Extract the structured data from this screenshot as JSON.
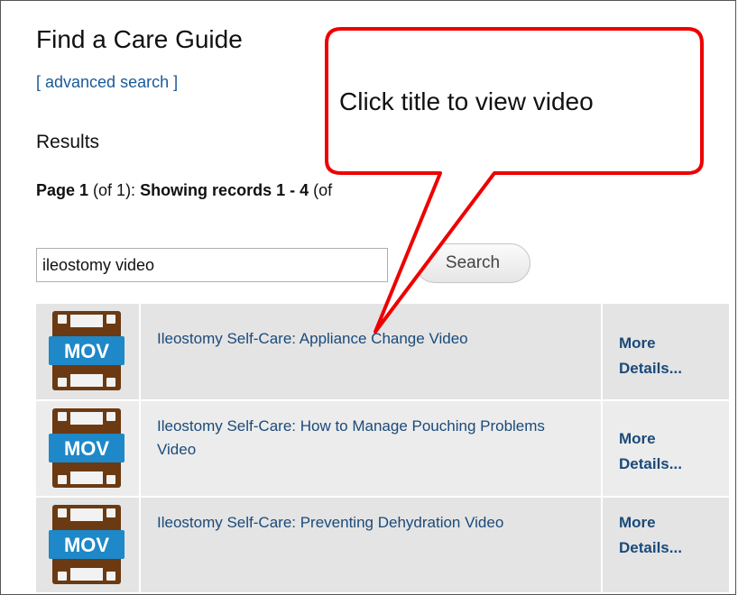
{
  "header": {
    "title": "Find a Care Guide",
    "advanced_search_link": "[ advanced search ]"
  },
  "results": {
    "heading": "Results",
    "page_label": "Page 1",
    "page_of": " (of 1): ",
    "showing_label": "Showing records 1 - 4",
    "showing_suffix": " (of"
  },
  "search": {
    "value": "ileostomy video",
    "button_label": "Search"
  },
  "items": [
    {
      "icon": "mov-file-icon",
      "icon_label": "MOV",
      "title": "Ileostomy Self-Care: Appliance Change Video",
      "more_label": "More Details..."
    },
    {
      "icon": "mov-file-icon",
      "icon_label": "MOV",
      "title": "Ileostomy Self-Care: How to Manage Pouching Problems Video",
      "more_label": "More Details..."
    },
    {
      "icon": "mov-file-icon",
      "icon_label": "MOV",
      "title": "Ileostomy Self-Care: Preventing Dehydration Video",
      "more_label": "More Details..."
    }
  ],
  "callout": {
    "text": "Click title to view video",
    "border_color": "#ee0000"
  },
  "colors": {
    "link": "#1a4a7a",
    "row_bg": "#e4e4e4",
    "icon_brown": "#6b3a12",
    "icon_blue": "#1e88c8"
  }
}
